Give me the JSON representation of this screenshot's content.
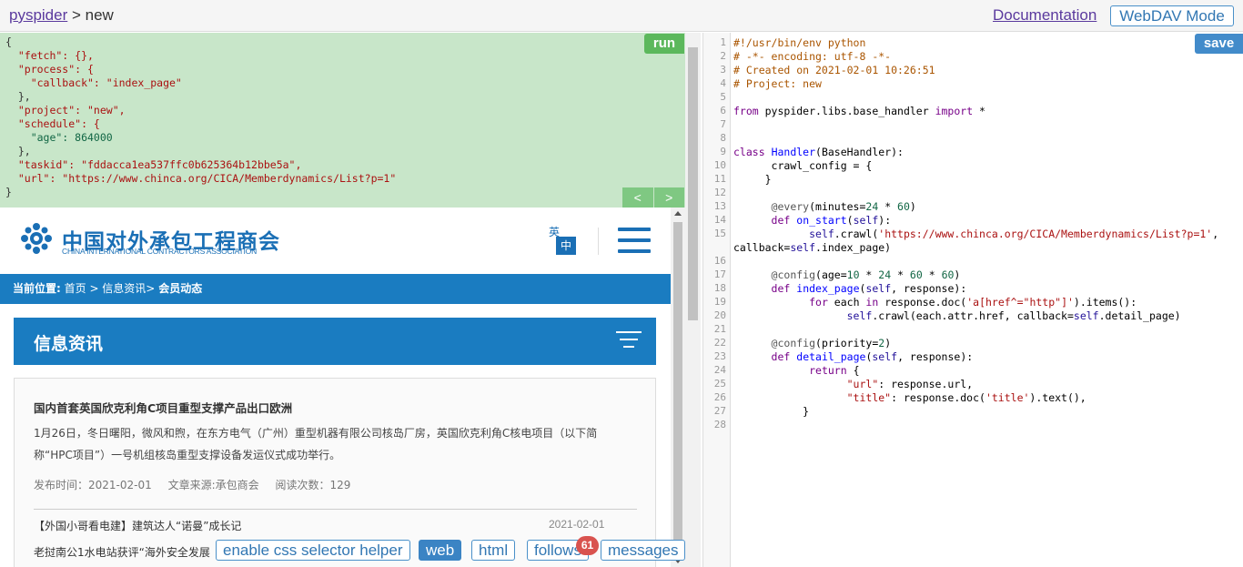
{
  "header": {
    "app_link": "pyspider",
    "separator": " > ",
    "project": "new",
    "documentation_link": "Documentation",
    "webdav_button": "WebDAV Mode"
  },
  "task_panel": {
    "run_button": "run",
    "prev_button": "<",
    "next_button": ">",
    "lines": [
      "{",
      "  \"fetch\": {},",
      "  \"process\": {",
      "    \"callback\": \"index_page\"",
      "  },",
      "  \"project\": \"new\",",
      "  \"schedule\": {",
      "    \"age\": 864000",
      "  },",
      "  \"taskid\": \"fddacca1ea537ffc0b625364b12bbe5a\",",
      "  \"url\": \"https://www.chinca.org/CICA/Memberdynamics/List?p=1\"",
      "}"
    ]
  },
  "preview": {
    "logo_cn": "中国对外承包工程商会",
    "logo_en": "CHINA INTERNATIONAL CONTRACTORS ASSOCIATION",
    "lang_en": "英",
    "lang_zh": "中",
    "location_label": "当前位置:",
    "location_path": " 首页 > 信息资讯> ",
    "location_current": "会员动态",
    "section_title": "信息资讯",
    "article": {
      "title": "国内首套英国欣克利角C项目重型支撑产品出口欧洲",
      "description": "1月26日，冬日曙阳，微风和煦，在东方电气（广州）重型机器有限公司核岛厂房，英国欣克利角C核电项目（以下简称“HPC项目”）一号机组核岛重型支撑设备发运仪式成功举行。",
      "publish_time": "发布时间：2021-02-01",
      "source": "文章来源:承包商会",
      "reads": "阅读次数：129"
    },
    "article2": {
      "title": "【外国小哥看电建】建筑达人“诺曼”成长记",
      "date": "2021-02-01"
    },
    "article3": {
      "title": "老挝南公1水电站获评“海外安全发展"
    }
  },
  "toolbar": {
    "css_helper": "enable css selector helper",
    "web": "web",
    "html": "html",
    "follows": "follows",
    "follows_count": "61",
    "messages": "messages"
  },
  "editor": {
    "save_button": "save",
    "line_numbers": [
      "1",
      "2",
      "3",
      "4",
      "5",
      "6",
      "7",
      "8",
      "9",
      "10",
      "11",
      "12",
      "13",
      "14",
      "15",
      "",
      "16",
      "17",
      "18",
      "19",
      "20",
      "21",
      "22",
      "23",
      "24",
      "25",
      "26",
      "27",
      "28"
    ]
  },
  "colors": {
    "task_bg": "#c8e6c9",
    "run_green": "#5cb85c",
    "save_blue": "#428bca",
    "site_blue": "#1a7cc1",
    "badge_red": "#d9534f"
  }
}
